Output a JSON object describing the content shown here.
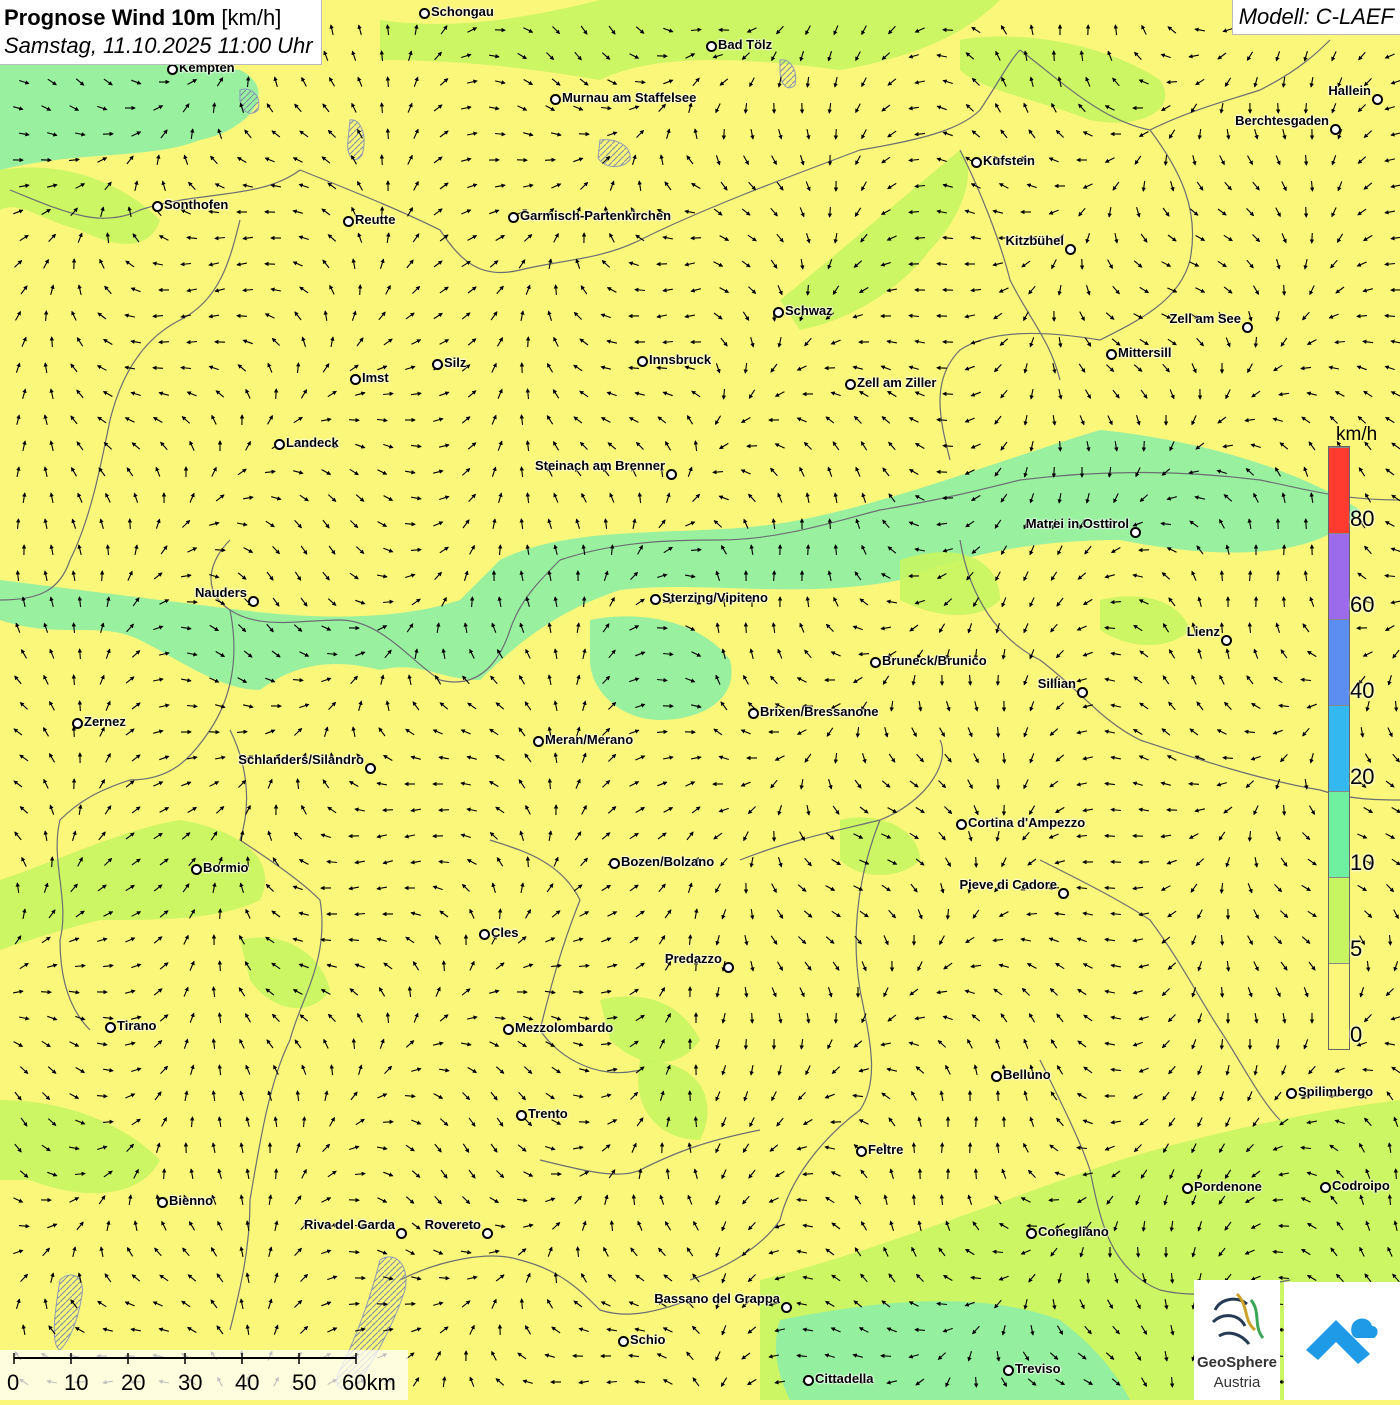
{
  "title": {
    "main_bold": "Prognose Wind 10m",
    "main_unit": "[km/h]",
    "subtitle": "Samstag, 11.10.2025 11:00 Uhr"
  },
  "model": "Modell: C-LAEF",
  "legend": {
    "unit": "km/h",
    "labels": [
      "80",
      "60",
      "40",
      "20",
      "10",
      "5",
      "0"
    ],
    "colors": [
      "#ff3b30",
      "#9b6bec",
      "#5b8ef0",
      "#33b8f0",
      "#6ff0a0",
      "#c6f561",
      "#fbf77a"
    ]
  },
  "colors": {
    "calm": "#fbf77a",
    "light": "#c6f561",
    "moderate": "#8ef0a4"
  },
  "scale": {
    "labels": [
      "0",
      "10",
      "20",
      "30",
      "40",
      "50",
      "60km"
    ]
  },
  "logo": {
    "name": "GeoSphere",
    "sub": "Austria"
  },
  "cities": [
    {
      "name": "Schongau",
      "side": "r"
    },
    {
      "name": "Bad Tölz",
      "side": "r"
    },
    {
      "name": "Kempten",
      "side": "r"
    },
    {
      "name": "Murnau am Staffelsee",
      "side": "r"
    },
    {
      "name": "Hallein",
      "side": "l"
    },
    {
      "name": "Berchtesgaden",
      "side": "l"
    },
    {
      "name": "Kufstein",
      "side": "r"
    },
    {
      "name": "Sonthofen",
      "side": "r"
    },
    {
      "name": "Reutte",
      "side": "r"
    },
    {
      "name": "Garmisch-Partenkirchen",
      "side": "r"
    },
    {
      "name": "Kitzbühel",
      "side": "l"
    },
    {
      "name": "Schwaz",
      "side": "r"
    },
    {
      "name": "Zell am See",
      "side": "l"
    },
    {
      "name": "Mittersill",
      "side": "r"
    },
    {
      "name": "Innsbruck",
      "side": "r"
    },
    {
      "name": "Silz",
      "side": "r"
    },
    {
      "name": "Imst",
      "side": "r"
    },
    {
      "name": "Zell am Ziller",
      "side": "r"
    },
    {
      "name": "Landeck",
      "side": "r"
    },
    {
      "name": "Steinach am Brenner",
      "side": "l"
    },
    {
      "name": "Matrei in Osttirol",
      "side": "l"
    },
    {
      "name": "Nauders",
      "side": "l"
    },
    {
      "name": "Sterzing/Vipiteno",
      "side": "r"
    },
    {
      "name": "Lienz",
      "side": "l"
    },
    {
      "name": "Bruneck/Brunico",
      "side": "r"
    },
    {
      "name": "Sillian",
      "side": "l"
    },
    {
      "name": "Brixen/Bressanone",
      "side": "r"
    },
    {
      "name": "Zernez",
      "side": "r"
    },
    {
      "name": "Meran/Merano",
      "side": "r"
    },
    {
      "name": "Schlanders/Silandro",
      "side": "l"
    },
    {
      "name": "Cortina d'Ampezzo",
      "side": "r"
    },
    {
      "name": "Bozen/Bolzano",
      "side": "r"
    },
    {
      "name": "Bormio",
      "side": "r"
    },
    {
      "name": "Pieve di Cadore",
      "side": "l"
    },
    {
      "name": "Cles",
      "side": "r"
    },
    {
      "name": "Predazzo",
      "side": "l"
    },
    {
      "name": "Tirano",
      "side": "r"
    },
    {
      "name": "Mezzolombardo",
      "side": "r"
    },
    {
      "name": "Belluno",
      "side": "r"
    },
    {
      "name": "Spilimbergo",
      "side": "r"
    },
    {
      "name": "Trento",
      "side": "r"
    },
    {
      "name": "Feltre",
      "side": "r"
    },
    {
      "name": "Pordenone",
      "side": "r"
    },
    {
      "name": "Codroipo",
      "side": "r"
    },
    {
      "name": "Bienno",
      "side": "r"
    },
    {
      "name": "Riva del Garda",
      "side": "l"
    },
    {
      "name": "Rovereto",
      "side": "l"
    },
    {
      "name": "Conegliano",
      "side": "r"
    },
    {
      "name": "Bassano del Grappa",
      "side": "l"
    },
    {
      "name": "Schio",
      "side": "r"
    },
    {
      "name": "Treviso",
      "side": "r"
    },
    {
      "name": "Cittadella",
      "side": "r"
    }
  ]
}
